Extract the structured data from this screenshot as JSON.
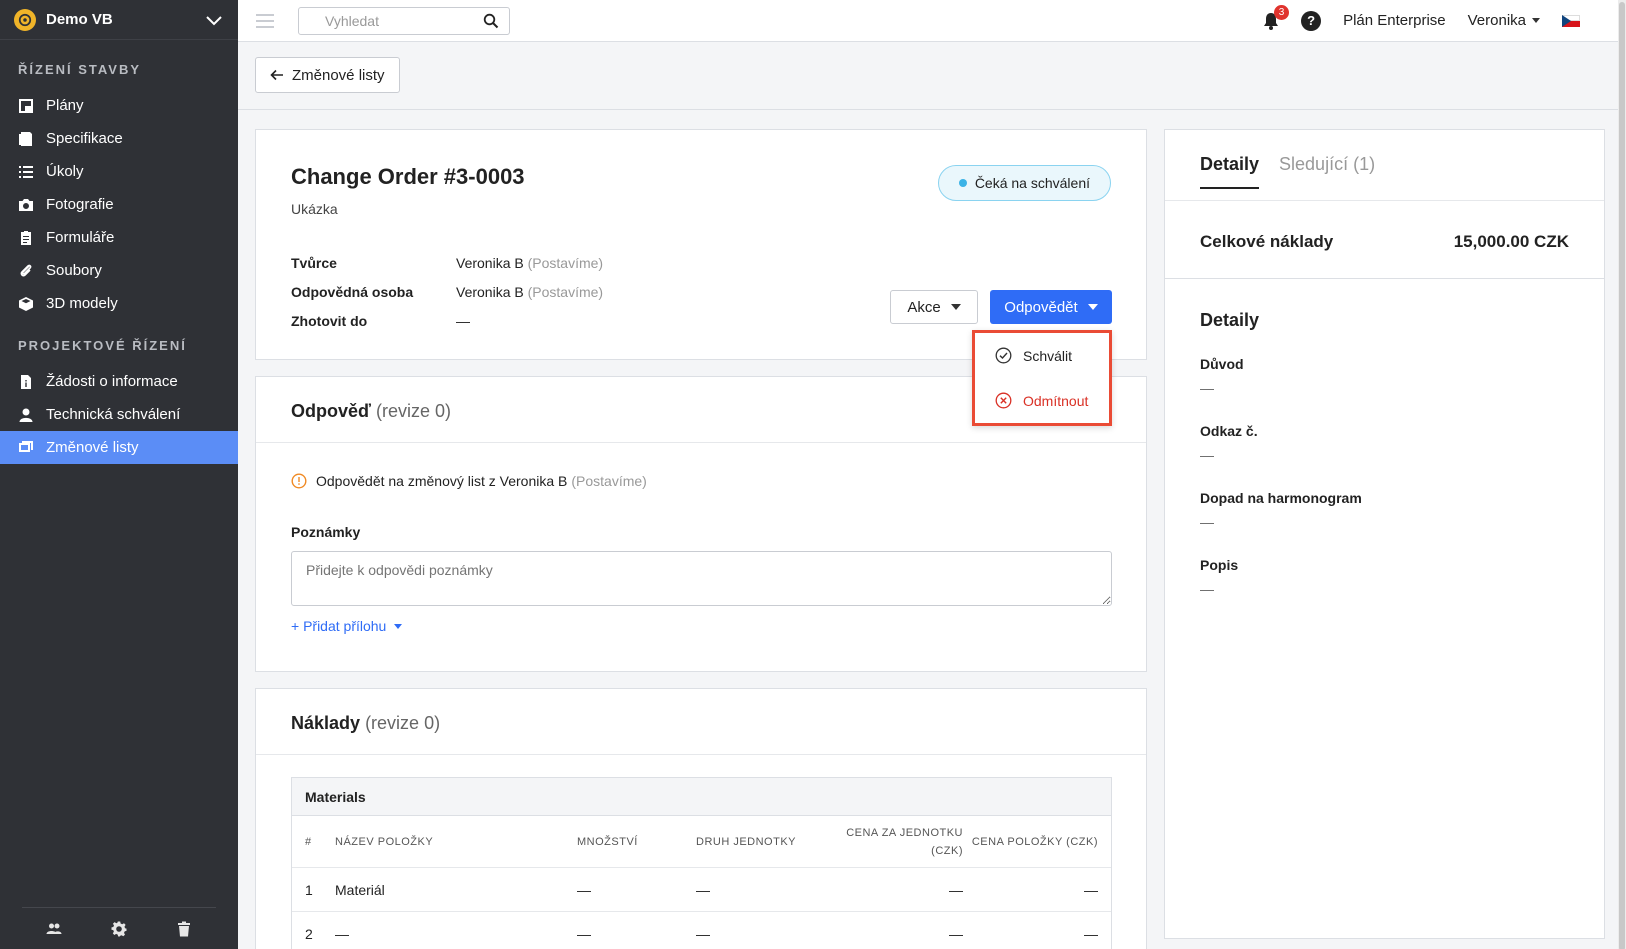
{
  "brand": {
    "name": "Demo VB",
    "logo_color": "#f0b429"
  },
  "sidebar": {
    "section1_title": "ŘÍZENÍ STAVBY",
    "section1_items": [
      {
        "label": "Plány",
        "icon": "plans-icon"
      },
      {
        "label": "Specifikace",
        "icon": "specs-icon"
      },
      {
        "label": "Úkoly",
        "icon": "list-icon"
      },
      {
        "label": "Fotografie",
        "icon": "camera-icon"
      },
      {
        "label": "Formuláře",
        "icon": "clipboard-icon"
      },
      {
        "label": "Soubory",
        "icon": "paperclip-icon"
      },
      {
        "label": "3D modely",
        "icon": "cube-icon"
      }
    ],
    "section2_title": "PROJEKTOVÉ ŘÍZENÍ",
    "section2_items": [
      {
        "label": "Žádosti o informace",
        "icon": "info-doc-icon"
      },
      {
        "label": "Technická schválení",
        "icon": "person-icon"
      },
      {
        "label": "Změnové listy",
        "icon": "change-order-icon",
        "active": true
      }
    ],
    "active_color": "#5b8df6"
  },
  "topbar": {
    "search_placeholder": "Vyhledat",
    "notifications_count": "3",
    "help": "?",
    "plan": "Plán Enterprise",
    "user": "Veronika"
  },
  "back_button": "Změnové listy",
  "order": {
    "title": "Change Order #3-0003",
    "subtitle": "Ukázka",
    "status": "Čeká na schválení",
    "fields": [
      {
        "label": "Tvůrce",
        "value": "Veronika B",
        "company": "(Postavíme)"
      },
      {
        "label": "Odpovědná osoba",
        "value": "Veronika B",
        "company": "(Postavíme)"
      },
      {
        "label": "Zhotovit do",
        "value": "—",
        "company": ""
      }
    ],
    "actions_button": "Akce",
    "respond_button": "Odpovědět"
  },
  "dropdown": {
    "approve": "Schválit",
    "reject": "Odmítnout"
  },
  "response": {
    "title": "Odpověď",
    "revision": "(revize 0)",
    "notice": "Odpovědět na změnový list z Veronika B",
    "notice_company": "(Postavíme)",
    "notes_label": "Poznámky",
    "notes_placeholder": "Přidejte k odpovědi poznámky",
    "add_attachment": "+ Přidat přílohu"
  },
  "costs": {
    "title": "Náklady",
    "revision": "(revize 0)",
    "group": "Materials",
    "headers": [
      "#",
      "NÁZEV POLOŽKY",
      "MNOŽSTVÍ",
      "DRUH JEDNOTKY",
      "CENA ZA JEDNOTKU (CZK)",
      "CENA POLOŽKY (CZK)"
    ],
    "rows": [
      [
        "1",
        "Materiál",
        "—",
        "—",
        "—",
        "—"
      ],
      [
        "2",
        "—",
        "—",
        "—",
        "—",
        "—"
      ]
    ]
  },
  "panel": {
    "tab_details": "Detaily",
    "tab_followers": "Sledující (1)",
    "total_label": "Celkové náklady",
    "total_value": "15,000.00 CZK",
    "details_title": "Detaily",
    "items": [
      {
        "label": "Důvod",
        "value": "—"
      },
      {
        "label": "Odkaz č.",
        "value": "—"
      },
      {
        "label": "Dopad na harmonogram",
        "value": "—"
      },
      {
        "label": "Popis",
        "value": "—"
      }
    ]
  }
}
